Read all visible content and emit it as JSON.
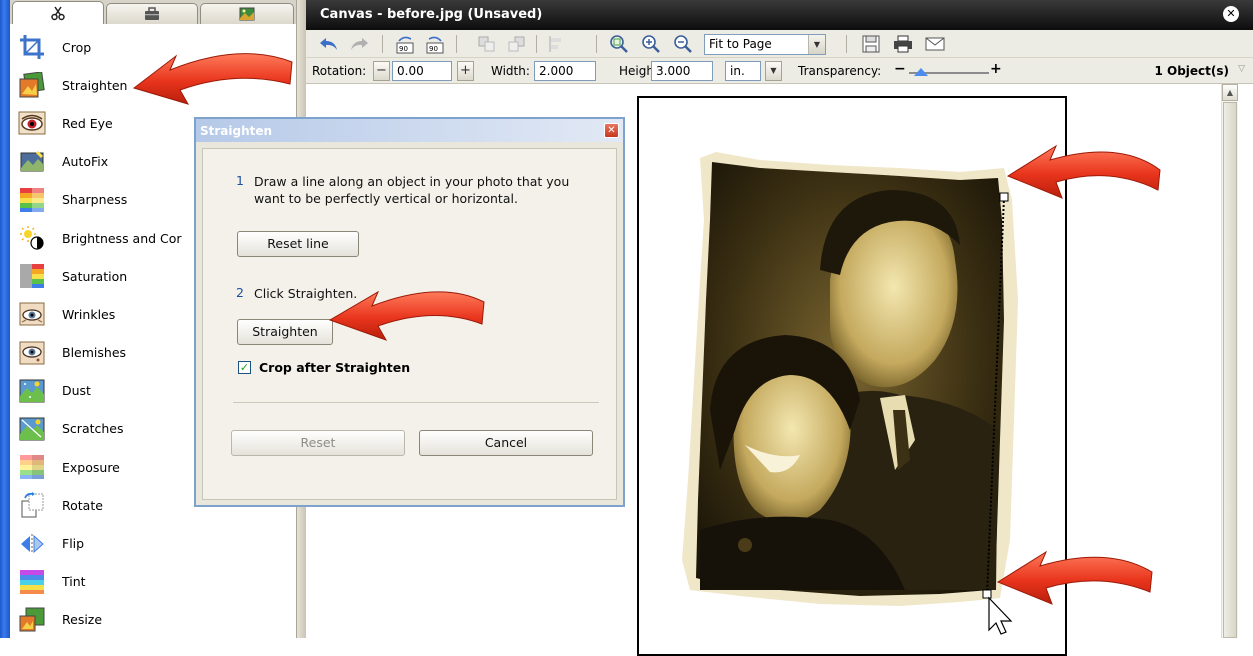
{
  "tools": {
    "items": [
      {
        "label": "Crop",
        "icon": "crop-icon"
      },
      {
        "label": "Straighten",
        "icon": "straighten-icon"
      },
      {
        "label": "Red Eye",
        "icon": "red-eye-icon"
      },
      {
        "label": "AutoFix",
        "icon": "autofix-icon"
      },
      {
        "label": "Sharpness",
        "icon": "sharpness-icon"
      },
      {
        "label": "Brightness and Cor",
        "icon": "brightness-contrast-icon"
      },
      {
        "label": "Saturation",
        "icon": "saturation-icon"
      },
      {
        "label": "Wrinkles",
        "icon": "wrinkles-icon"
      },
      {
        "label": "Blemishes",
        "icon": "blemishes-icon"
      },
      {
        "label": "Dust",
        "icon": "dust-icon"
      },
      {
        "label": "Scratches",
        "icon": "scratches-icon"
      },
      {
        "label": "Exposure",
        "icon": "exposure-icon"
      },
      {
        "label": "Rotate",
        "icon": "rotate-icon"
      },
      {
        "label": "Flip",
        "icon": "flip-icon"
      },
      {
        "label": "Tint",
        "icon": "tint-icon"
      },
      {
        "label": "Resize",
        "icon": "resize-icon"
      }
    ]
  },
  "canvas": {
    "title": "Canvas - before.jpg (Unsaved)",
    "zoom_select": "Fit to Page",
    "rotation_label": "Rotation:",
    "rotation_value": "0.00",
    "width_label": "Width:",
    "width_value": "2.000",
    "height_label": "Height:",
    "height_value": "3.000",
    "unit": "in.",
    "transparency_label": "Transparency:",
    "transparency_level": 0.15,
    "objects_count": "1 Object(s)"
  },
  "dialog": {
    "title": "Straighten",
    "step1_num": "1",
    "step1_text": "Draw a line along an object in your photo that you want to be perfectly vertical or horizontal.",
    "reset_line_button": "Reset line",
    "step2_num": "2",
    "step2_text": "Click Straighten.",
    "straighten_button": "Straighten",
    "crop_checkbox_label": "Crop after Straighten",
    "crop_checked": true,
    "reset_button": "Reset",
    "cancel_button": "Cancel"
  },
  "colors": {
    "arrow": "#e8341c",
    "title_bar": "#111111",
    "dialog_border": "#7da2ce",
    "xp_blue": "#2b6ae0"
  }
}
